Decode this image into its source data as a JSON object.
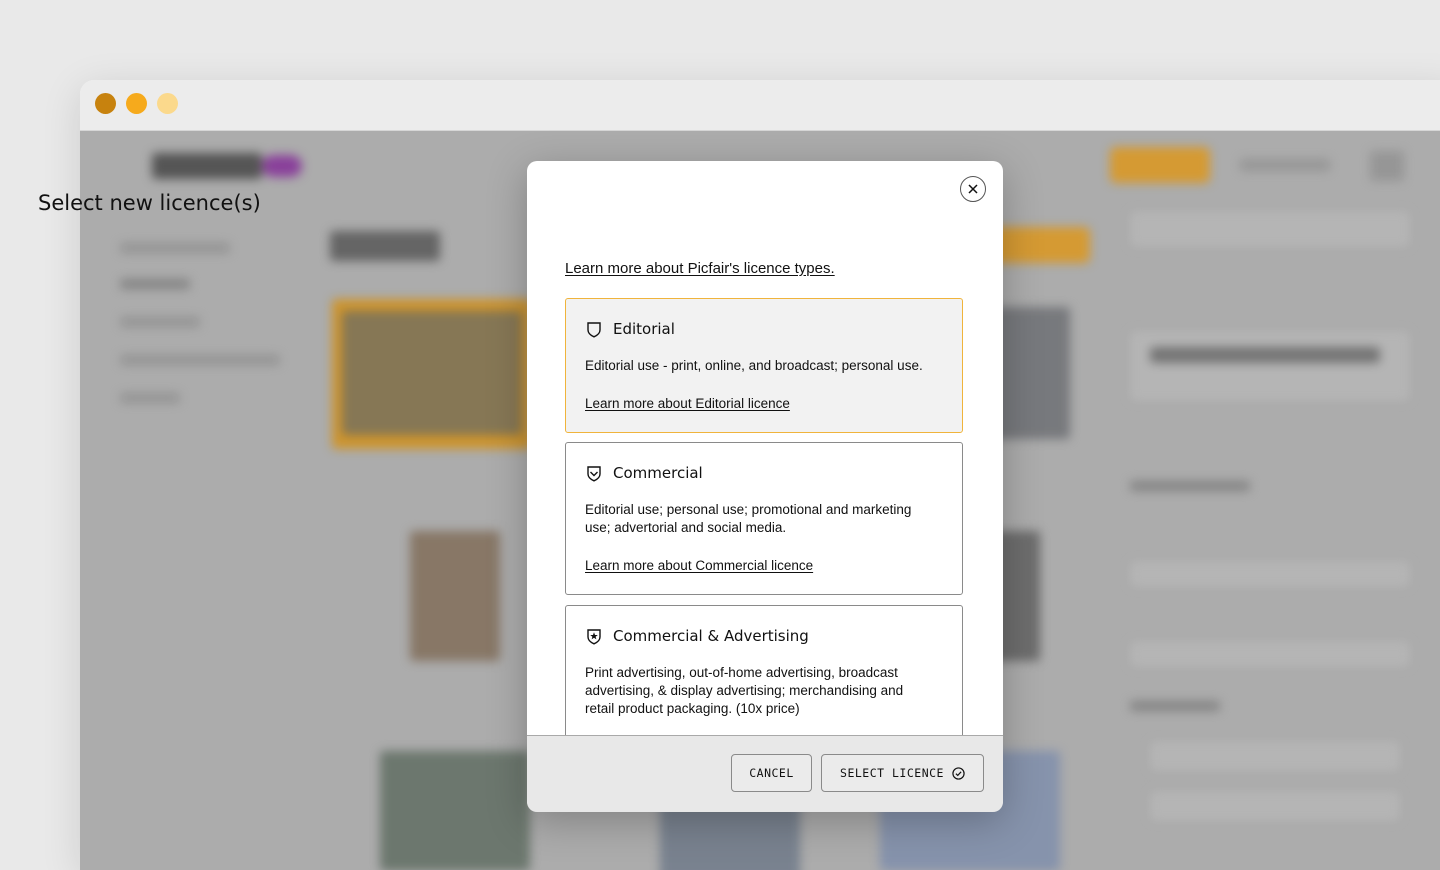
{
  "window": {
    "controls": [
      "close",
      "minimize",
      "zoom"
    ]
  },
  "modal": {
    "title": "Select new licence(s)",
    "learn_link": "Learn more about Picfair's licence types.",
    "close_icon": "close-icon",
    "licences": [
      {
        "name": "Editorial",
        "icon": "shield-icon",
        "description": "Editorial use - print, online, and broadcast; personal use.",
        "link": "Learn more about Editorial licence",
        "selected": true
      },
      {
        "name": "Commercial",
        "icon": "shield-chevron-icon",
        "description": "Editorial use; personal use; promotional and marketing use; advertorial and social media.",
        "link": "Learn more about Commercial licence",
        "selected": false
      },
      {
        "name": "Commercial & Advertising",
        "icon": "shield-star-icon",
        "description": "Print advertising, out-of-home advertising, broadcast advertising, & display advertising; merchandising and retail product packaging. (10x price)",
        "link": "",
        "selected": false
      }
    ],
    "footer": {
      "cancel_label": "CANCEL",
      "select_label": "SELECT LICENCE",
      "select_icon": "check-circle-icon"
    }
  },
  "colors": {
    "accent": "#f6aa1c",
    "selected_border": "#f0b43c",
    "window_close": "#c7820e",
    "window_min": "#f6aa1c",
    "window_max": "#fbd98c"
  }
}
